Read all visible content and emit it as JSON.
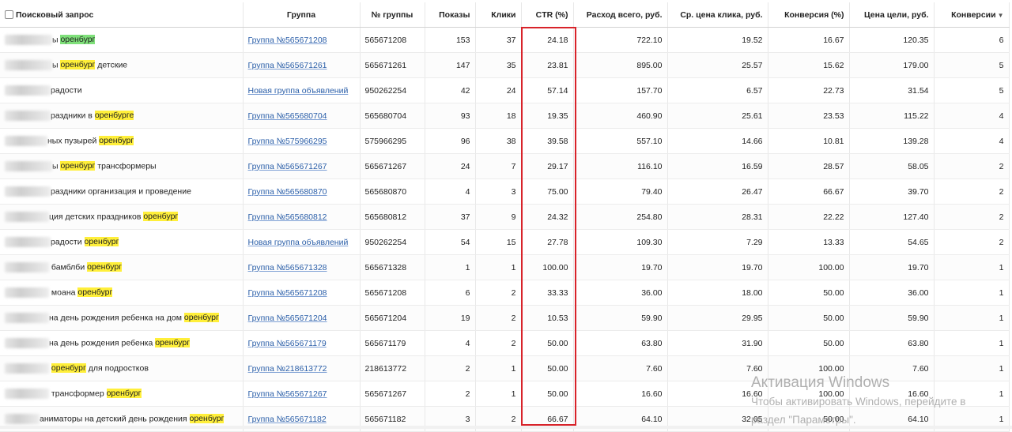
{
  "columns": [
    "Поисковый запрос",
    "Группа",
    "№ группы",
    "Показы",
    "Клики",
    "CTR (%)",
    "Расход всего, руб.",
    "Ср. цена клика, руб.",
    "Конверсия (%)",
    "Цена цели, руб.",
    "Конверсии"
  ],
  "sort_indicator": "▼",
  "rows": [
    {
      "q_blur": 60,
      "q_pre": "ы ",
      "q_hl": "оренбург",
      "q_hl_color": "green",
      "q_post": "",
      "group": "Группа №565671208",
      "group_id": "565671208",
      "shows": "153",
      "clicks": "37",
      "ctr": "24.18",
      "spend": "722.10",
      "cpc": "19.52",
      "conv_rate": "16.67",
      "goal_price": "120.35",
      "conversions": "6"
    },
    {
      "q_blur": 60,
      "q_pre": "ы ",
      "q_hl": "оренбург",
      "q_hl_color": "yellow",
      "q_post": " детские",
      "group": "Группа №565671261",
      "group_id": "565671261",
      "shows": "147",
      "clicks": "35",
      "ctr": "23.81",
      "spend": "895.00",
      "cpc": "25.57",
      "conv_rate": "15.62",
      "goal_price": "179.00",
      "conversions": "5"
    },
    {
      "q_blur": 58,
      "q_pre": "радости",
      "q_hl": "",
      "q_hl_color": "",
      "q_post": "",
      "group": "Новая группа объявлений",
      "group_id": "950262254",
      "shows": "42",
      "clicks": "24",
      "ctr": "57.14",
      "spend": "157.70",
      "cpc": "6.57",
      "conv_rate": "22.73",
      "goal_price": "31.54",
      "conversions": "5"
    },
    {
      "q_blur": 58,
      "q_pre": "раздники в ",
      "q_hl": "оренбурге",
      "q_hl_color": "yellow",
      "q_post": "",
      "group": "Группа №565680704",
      "group_id": "565680704",
      "shows": "93",
      "clicks": "18",
      "ctr": "19.35",
      "spend": "460.90",
      "cpc": "25.61",
      "conv_rate": "23.53",
      "goal_price": "115.22",
      "conversions": "4"
    },
    {
      "q_blur": 54,
      "q_pre": "ных пузырей ",
      "q_hl": "оренбург",
      "q_hl_color": "yellow",
      "q_post": "",
      "group": "Группа №575966295",
      "group_id": "575966295",
      "shows": "96",
      "clicks": "38",
      "ctr": "39.58",
      "spend": "557.10",
      "cpc": "14.66",
      "conv_rate": "10.81",
      "goal_price": "139.28",
      "conversions": "4"
    },
    {
      "q_blur": 60,
      "q_pre": "ы ",
      "q_hl": "оренбург",
      "q_hl_color": "yellow",
      "q_post": " трансформеры",
      "group": "Группа №565671267",
      "group_id": "565671267",
      "shows": "24",
      "clicks": "7",
      "ctr": "29.17",
      "spend": "116.10",
      "cpc": "16.59",
      "conv_rate": "28.57",
      "goal_price": "58.05",
      "conversions": "2"
    },
    {
      "q_blur": 58,
      "q_pre": "раздники организация и проведение",
      "q_hl": "",
      "q_hl_color": "",
      "q_post": "",
      "group": "Группа №565680870",
      "group_id": "565680870",
      "shows": "4",
      "clicks": "3",
      "ctr": "75.00",
      "spend": "79.40",
      "cpc": "26.47",
      "conv_rate": "66.67",
      "goal_price": "39.70",
      "conversions": "2"
    },
    {
      "q_blur": 56,
      "q_pre": "ция детских праздников ",
      "q_hl": "оренбург",
      "q_hl_color": "yellow",
      "q_post": "",
      "group": "Группа №565680812",
      "group_id": "565680812",
      "shows": "37",
      "clicks": "9",
      "ctr": "24.32",
      "spend": "254.80",
      "cpc": "28.31",
      "conv_rate": "22.22",
      "goal_price": "127.40",
      "conversions": "2"
    },
    {
      "q_blur": 58,
      "q_pre": "радости ",
      "q_hl": "оренбург",
      "q_hl_color": "yellow",
      "q_post": "",
      "group": "Новая группа объявлений",
      "group_id": "950262254",
      "shows": "54",
      "clicks": "15",
      "ctr": "27.78",
      "spend": "109.30",
      "cpc": "7.29",
      "conv_rate": "13.33",
      "goal_price": "54.65",
      "conversions": "2"
    },
    {
      "q_blur": 56,
      "q_pre": " бамблби ",
      "q_hl": "оренбург",
      "q_hl_color": "yellow",
      "q_post": "",
      "group": "Группа №565671328",
      "group_id": "565671328",
      "shows": "1",
      "clicks": "1",
      "ctr": "100.00",
      "spend": "19.70",
      "cpc": "19.70",
      "conv_rate": "100.00",
      "goal_price": "19.70",
      "conversions": "1"
    },
    {
      "q_blur": 56,
      "q_pre": " моана ",
      "q_hl": "оренбург",
      "q_hl_color": "yellow",
      "q_post": "",
      "group": "Группа №565671208",
      "group_id": "565671208",
      "shows": "6",
      "clicks": "2",
      "ctr": "33.33",
      "spend": "36.00",
      "cpc": "18.00",
      "conv_rate": "50.00",
      "goal_price": "36.00",
      "conversions": "1"
    },
    {
      "q_blur": 56,
      "q_pre": "на день рождения ребенка на дом ",
      "q_hl": "оренбург",
      "q_hl_color": "yellow",
      "q_post": "",
      "group": "Группа №565671204",
      "group_id": "565671204",
      "shows": "19",
      "clicks": "2",
      "ctr": "10.53",
      "spend": "59.90",
      "cpc": "29.95",
      "conv_rate": "50.00",
      "goal_price": "59.90",
      "conversions": "1"
    },
    {
      "q_blur": 56,
      "q_pre": "на день рождения ребенка ",
      "q_hl": "оренбург",
      "q_hl_color": "yellow",
      "q_post": "",
      "group": "Группа №565671179",
      "group_id": "565671179",
      "shows": "4",
      "clicks": "2",
      "ctr": "50.00",
      "spend": "63.80",
      "cpc": "31.90",
      "conv_rate": "50.00",
      "goal_price": "63.80",
      "conversions": "1"
    },
    {
      "q_blur": 56,
      "q_pre": " ",
      "q_hl": "оренбург",
      "q_hl_color": "yellow",
      "q_post": " для подростков",
      "group": "Группа №218613772",
      "group_id": "218613772",
      "shows": "2",
      "clicks": "1",
      "ctr": "50.00",
      "spend": "7.60",
      "cpc": "7.60",
      "conv_rate": "100.00",
      "goal_price": "7.60",
      "conversions": "1"
    },
    {
      "q_blur": 56,
      "q_pre": " трансформер ",
      "q_hl": "оренбург",
      "q_hl_color": "yellow",
      "q_post": "",
      "group": "Группа №565671267",
      "group_id": "565671267",
      "shows": "2",
      "clicks": "1",
      "ctr": "50.00",
      "spend": "16.60",
      "cpc": "16.60",
      "conv_rate": "100.00",
      "goal_price": "16.60",
      "conversions": "1"
    },
    {
      "q_blur": 44,
      "q_pre": "аниматоры на детский день рождения ",
      "q_hl": "оренбург",
      "q_hl_color": "yellow",
      "q_post": "",
      "group": "Группа №565671182",
      "group_id": "565671182",
      "shows": "3",
      "clicks": "2",
      "ctr": "66.67",
      "spend": "64.10",
      "cpc": "32.05",
      "conv_rate": "50.00",
      "goal_price": "64.10",
      "conversions": "1"
    }
  ],
  "watermark": {
    "title": "Активация Windows",
    "line1": "Чтобы активировать Windows, перейдите в",
    "line2": "раздел \"Параметры\"."
  },
  "colors": {
    "highlight_yellow": "#ffef3a",
    "highlight_green": "#7fe07a",
    "link": "#2a5ea8",
    "ctr_frame": "#d8232a"
  }
}
